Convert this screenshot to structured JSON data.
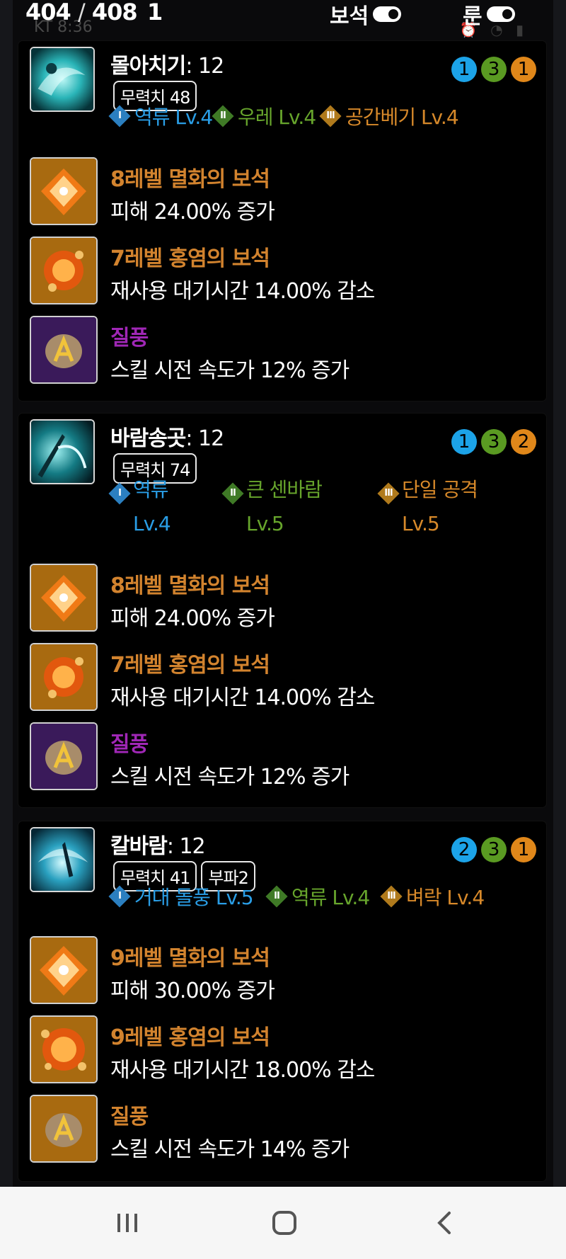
{
  "status": {
    "carrier": "KT",
    "time": "8:36"
  },
  "header": {
    "count_current": "404",
    "count_separator": "/",
    "count_total": "408",
    "count_extra": "1",
    "gem_toggle_label": "보석",
    "rune_toggle_label": "룬"
  },
  "colors": {
    "gold": "#d2832e",
    "purple": "#a027b6",
    "blue": "#1ca3e8",
    "green": "#5a9a22",
    "orange": "#e0871a"
  },
  "skills": [
    {
      "name": "몰아치기",
      "level_text": ": 12",
      "tags": [
        "무력치 48"
      ],
      "levels": [
        "1",
        "3",
        "1"
      ],
      "tripods": [
        {
          "roman": "I",
          "name": "역류 Lv.4"
        },
        {
          "roman": "II",
          "name": "우레 Lv.4"
        },
        {
          "roman": "III",
          "name": "공간베기 Lv.4"
        }
      ],
      "gems": [
        {
          "name": "8레벨 멸화의 보석",
          "desc": "피해 24.00% 증가",
          "icon": "doom-gem-icon"
        },
        {
          "name": "7레벨 홍염의 보석",
          "desc": "재사용 대기시간 14.00% 감소",
          "icon": "flame-gem-icon"
        }
      ],
      "rune": {
        "name": "질풍",
        "desc": "스킬 시전 속도가 12% 증가",
        "icon": "gale-rune-icon"
      }
    },
    {
      "name": "바람송곳",
      "level_text": ": 12",
      "tags": [
        "무력치 74"
      ],
      "levels": [
        "1",
        "3",
        "2"
      ],
      "tripods": [
        {
          "roman": "I",
          "name": "역류",
          "lv": "Lv.4"
        },
        {
          "roman": "II",
          "name": "큰 센바람",
          "lv": "Lv.5"
        },
        {
          "roman": "III",
          "name": "단일 공격",
          "lv": "Lv.5"
        }
      ],
      "gems": [
        {
          "name": "8레벨 멸화의 보석",
          "desc": "피해 24.00% 증가",
          "icon": "doom-gem-icon"
        },
        {
          "name": "7레벨 홍염의 보석",
          "desc": "재사용 대기시간 14.00% 감소",
          "icon": "flame-gem-icon"
        }
      ],
      "rune": {
        "name": "질풍",
        "desc": "스킬 시전 속도가 12% 증가",
        "icon": "gale-rune-icon"
      }
    },
    {
      "name": "칼바람",
      "level_text": ": 12",
      "tags": [
        "무력치 41",
        "부파2"
      ],
      "levels": [
        "2",
        "3",
        "1"
      ],
      "tripods": [
        {
          "roman": "I",
          "name": "거대 돌풍 Lv.5"
        },
        {
          "roman": "II",
          "name": "역류 Lv.4"
        },
        {
          "roman": "III",
          "name": "벼락 Lv.4"
        }
      ],
      "gems": [
        {
          "name": "9레벨 멸화의 보석",
          "desc": "피해 30.00% 증가",
          "icon": "doom-gem-icon"
        },
        {
          "name": "9레벨 홍염의 보석",
          "desc": "재사용 대기시간 18.00% 감소",
          "icon": "flame-gem-icon"
        }
      ],
      "rune": {
        "name": "질풍",
        "desc": "스킬 시전 속도가 14% 증가",
        "icon": "gale-rune-icon"
      }
    }
  ],
  "navbar": {
    "recents": "recents-icon",
    "home": "home-icon",
    "back": "back-icon"
  }
}
